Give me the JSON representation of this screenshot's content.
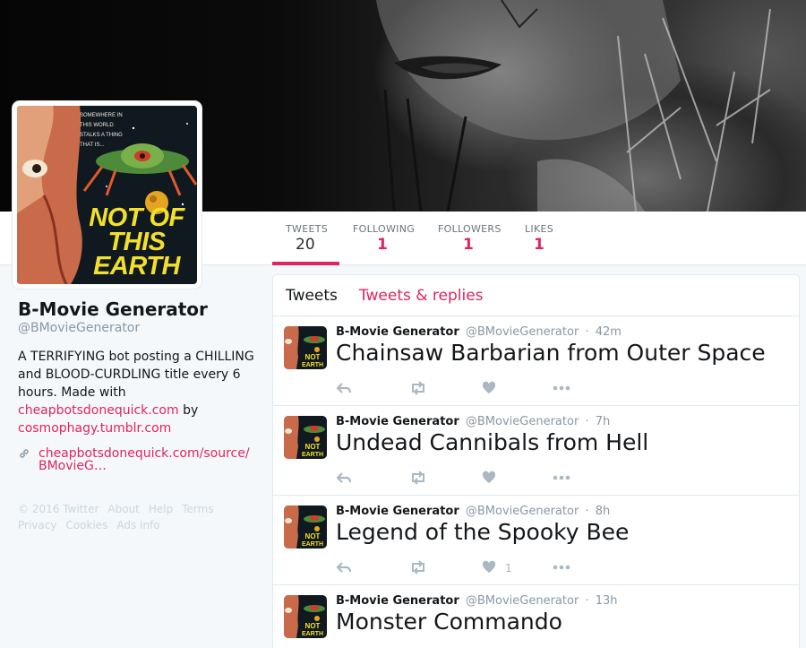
{
  "profile": {
    "name": "B-Movie Generator",
    "handle": "@BMovieGenerator",
    "bio_prefix": "A TERRIFYING bot posting a CHILLING and BLOOD-CURDLING title every 6 hours. Made with ",
    "bio_link1": "cheapbotsdonequick.com",
    "bio_mid": " by",
    "bio_link2": "cosmophagy.tumblr.com",
    "url": "cheapbotsdonequick.com/source/BMovieG…",
    "avatar_poster_text": "NOT OF THIS EARTH",
    "avatar_poster_tagline": "SOMEWHERE IN THIS WORLD STALKS A THING THAT IS..."
  },
  "stats": [
    {
      "label": "TWEETS",
      "value": "20"
    },
    {
      "label": "FOLLOWING",
      "value": "1"
    },
    {
      "label": "FOLLOWERS",
      "value": "1"
    },
    {
      "label": "LIKES",
      "value": "1"
    }
  ],
  "footer": {
    "line1": [
      "© 2016 Twitter",
      "About",
      "Help",
      "Terms"
    ],
    "line2": [
      "Privacy",
      "Cookies",
      "Ads info"
    ]
  },
  "tabs": [
    "Tweets",
    "Tweets & replies"
  ],
  "tweets": [
    {
      "name": "B-Movie Generator",
      "handle": "@BMovieGenerator",
      "sep": "·",
      "time": "42m",
      "text": "Chainsaw Barbarian from Outer Space",
      "likes": ""
    },
    {
      "name": "B-Movie Generator",
      "handle": "@BMovieGenerator",
      "sep": "·",
      "time": "7h",
      "text": "Undead Cannibals from Hell",
      "likes": ""
    },
    {
      "name": "B-Movie Generator",
      "handle": "@BMovieGenerator",
      "sep": "·",
      "time": "8h",
      "text": "Legend of the Spooky Bee",
      "likes": "1"
    },
    {
      "name": "B-Movie Generator",
      "handle": "@BMovieGenerator",
      "sep": "·",
      "time": "13h",
      "text": "Monster Commando",
      "likes": ""
    }
  ],
  "icons": {
    "reply": "reply-icon",
    "retweet": "retweet-icon",
    "like": "heart-icon",
    "more": "more-icon",
    "link": "link-icon"
  },
  "colors": {
    "accent": "#e0245e",
    "muted": "#8899a6",
    "border": "#e1e8ed"
  }
}
